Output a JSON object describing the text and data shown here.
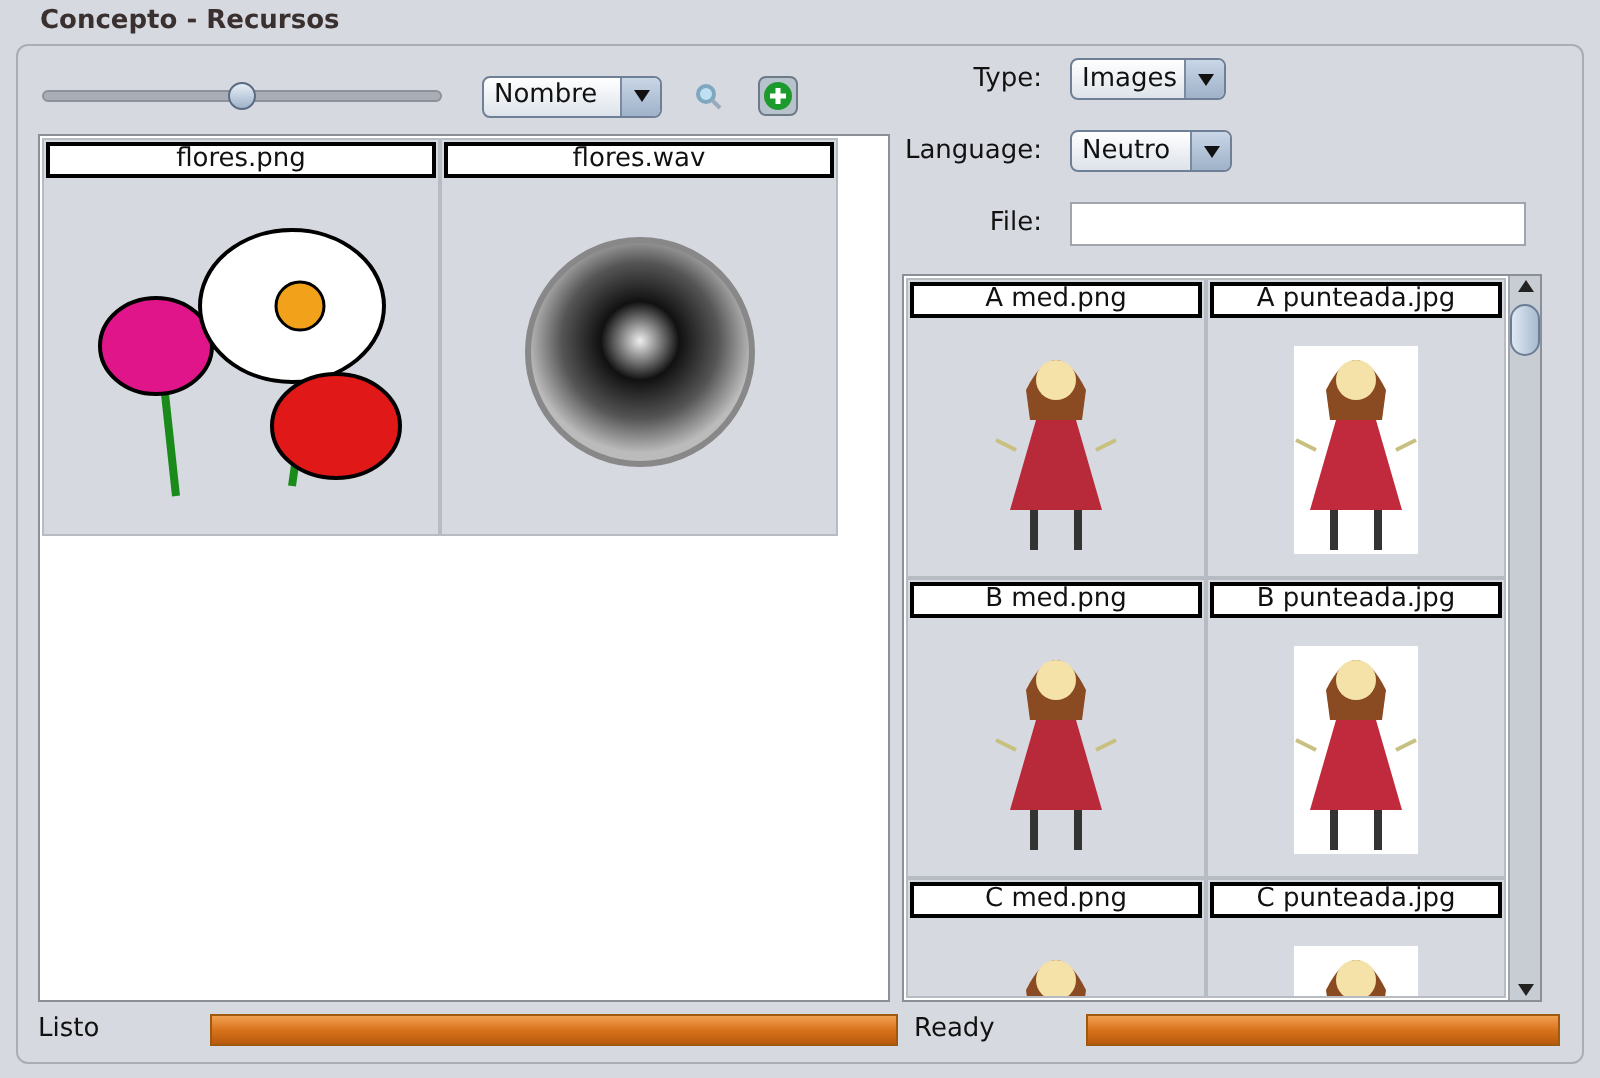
{
  "window": {
    "title": "Concepto - Recursos"
  },
  "toolbar": {
    "zoom_slider": {
      "level": 0.5
    },
    "sort": {
      "value": "Nombre"
    }
  },
  "left_items": [
    {
      "name": "flores.png",
      "kind": "image"
    },
    {
      "name": "flores.wav",
      "kind": "sound"
    }
  ],
  "filters": [
    {
      "label": "Type:",
      "kind": "select",
      "value": "Images"
    },
    {
      "label": "Language:",
      "kind": "select",
      "value": "Neutro"
    },
    {
      "label": "File:",
      "kind": "input"
    }
  ],
  "right_items": [
    {
      "name": "A med.png",
      "kind": "plain"
    },
    {
      "name": "A punteada.jpg",
      "kind": "traced"
    },
    {
      "name": "B med.png",
      "kind": "plain"
    },
    {
      "name": "B punteada.jpg",
      "kind": "traced"
    },
    {
      "name": "C med.png",
      "kind": "plain"
    },
    {
      "name": "C punteada.jpg",
      "kind": "traced"
    }
  ],
  "status": [
    {
      "text": "Listo",
      "level": 1
    },
    {
      "text": "Ready",
      "level": 1
    }
  ]
}
